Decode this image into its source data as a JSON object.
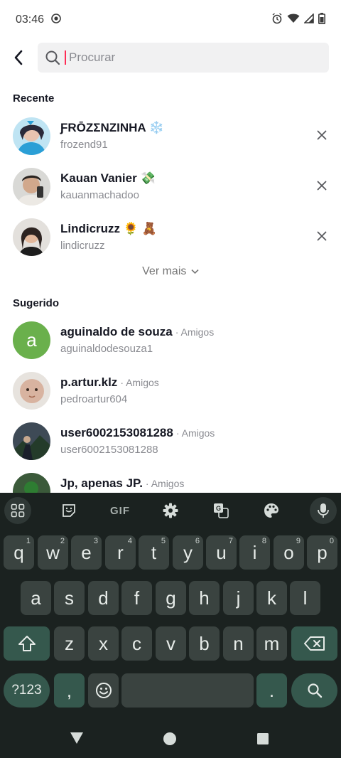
{
  "status": {
    "time": "03:46"
  },
  "search": {
    "placeholder": "Procurar",
    "value": ""
  },
  "recent": {
    "title": "Recente",
    "items": [
      {
        "name": "ƑRŌZΣNZINHA",
        "emoji": "❄️",
        "username": "frozend91"
      },
      {
        "name": "Kauan Vanier",
        "emoji": "💸",
        "username": "kauanmachadoo"
      },
      {
        "name": "Lindicruzz",
        "emoji": "🌻 🧸",
        "username": "lindicruzz"
      }
    ],
    "see_more": "Ver mais"
  },
  "suggested": {
    "title": "Sugerido",
    "items": [
      {
        "name": "aguinaldo de souza",
        "tag": "· Amigos",
        "username": "aguinaldodesouza1",
        "initial": "a"
      },
      {
        "name": "p.artur.klz",
        "tag": "· Amigos",
        "username": "pedroartur604"
      },
      {
        "name": "user6002153081288",
        "tag": "· Amigos",
        "username": "user6002153081288"
      },
      {
        "name": "Jp, apenas JP.",
        "tag": "· Amigos",
        "username": ""
      }
    ]
  },
  "keyboard": {
    "toolbar": [
      "apps-icon",
      "sticker-icon",
      "GIF",
      "settings-icon",
      "translate-icon",
      "palette-icon",
      "mic-icon"
    ],
    "gif_label": "GIF",
    "row1": [
      {
        "k": "q",
        "h": "1"
      },
      {
        "k": "w",
        "h": "2"
      },
      {
        "k": "e",
        "h": "3"
      },
      {
        "k": "r",
        "h": "4"
      },
      {
        "k": "t",
        "h": "5"
      },
      {
        "k": "y",
        "h": "6"
      },
      {
        "k": "u",
        "h": "7"
      },
      {
        "k": "i",
        "h": "8"
      },
      {
        "k": "o",
        "h": "9"
      },
      {
        "k": "p",
        "h": "0"
      }
    ],
    "row2": [
      "a",
      "s",
      "d",
      "f",
      "g",
      "h",
      "j",
      "k",
      "l"
    ],
    "row3": [
      "z",
      "x",
      "c",
      "v",
      "b",
      "n",
      "m"
    ],
    "sym_label": "?123",
    "comma": ",",
    "period": ".",
    "colors": {
      "bg": "#1b2220",
      "key": "#3a4340",
      "accent": "#35584d"
    }
  }
}
